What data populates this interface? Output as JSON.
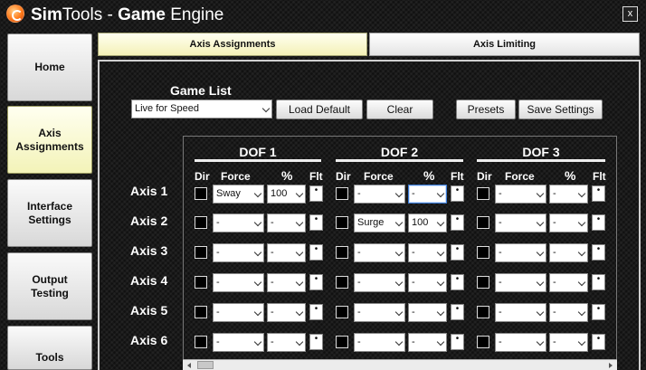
{
  "window": {
    "title_part1": "Sim",
    "title_part2": "Tools - ",
    "title_part3": "Game",
    "title_part4": " Engine",
    "close_label": "x"
  },
  "nav": {
    "home": "Home",
    "axis_assignments": "Axis Assignments",
    "interface_settings": "Interface Settings",
    "output_testing": "Output Testing",
    "tools": "Tools"
  },
  "tabs": {
    "axis_assignments": "Axis Assignments",
    "axis_limiting": "Axis Limiting"
  },
  "game_list": {
    "label": "Game List",
    "selected": "Live for Speed"
  },
  "buttons": {
    "load_default": "Load Default",
    "clear": "Clear",
    "presets": "Presets",
    "save_settings": "Save Settings"
  },
  "dofs": [
    "DOF 1",
    "DOF 2",
    "DOF 3"
  ],
  "columns": {
    "dir": "Dir",
    "force": "Force",
    "percent": "%",
    "flt": "Flt"
  },
  "axes": [
    {
      "label": "Axis 1",
      "dof": [
        {
          "force": "Sway",
          "percent": "100"
        },
        {
          "force": "-",
          "percent": "-"
        },
        {
          "force": "-",
          "percent": "-"
        }
      ]
    },
    {
      "label": "Axis 2",
      "dof": [
        {
          "force": "-",
          "percent": "-"
        },
        {
          "force": "Surge",
          "percent": "100"
        },
        {
          "force": "-",
          "percent": "-"
        }
      ]
    },
    {
      "label": "Axis 3",
      "dof": [
        {
          "force": "-",
          "percent": "-"
        },
        {
          "force": "-",
          "percent": "-"
        },
        {
          "force": "-",
          "percent": "-"
        }
      ]
    },
    {
      "label": "Axis 4",
      "dof": [
        {
          "force": "-",
          "percent": "-"
        },
        {
          "force": "-",
          "percent": "-"
        },
        {
          "force": "-",
          "percent": "-"
        }
      ]
    },
    {
      "label": "Axis 5",
      "dof": [
        {
          "force": "-",
          "percent": "-"
        },
        {
          "force": "-",
          "percent": "-"
        },
        {
          "force": "-",
          "percent": "-"
        }
      ]
    },
    {
      "label": "Axis 6",
      "dof": [
        {
          "force": "-",
          "percent": "-"
        },
        {
          "force": "-",
          "percent": "-"
        },
        {
          "force": "-",
          "percent": "-"
        }
      ]
    }
  ],
  "flt_glyph": "•",
  "colors": {
    "active_nav": "#f3f3b8",
    "focus": "#3b7bd6"
  }
}
